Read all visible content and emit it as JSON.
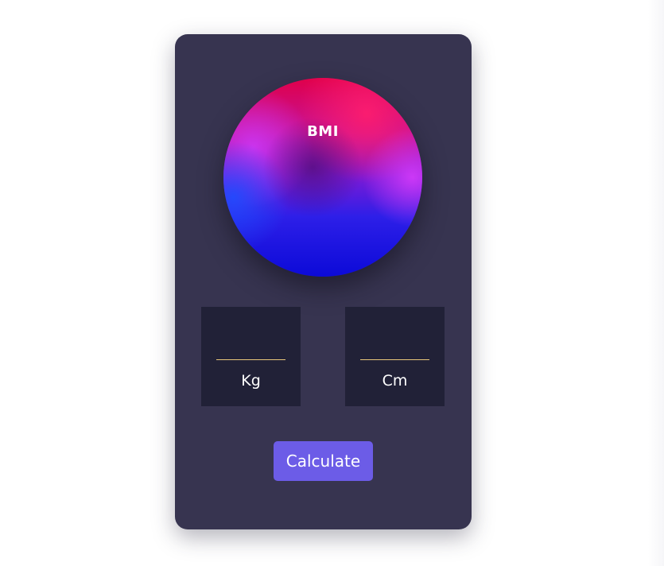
{
  "app": {
    "badge_title": "BMI"
  },
  "inputs": {
    "weight": {
      "value": "",
      "unit_label": "Kg"
    },
    "height": {
      "value": "",
      "unit_label": "Cm"
    }
  },
  "actions": {
    "calculate_label": "Calculate"
  },
  "colors": {
    "card_bg": "#373450",
    "input_box_bg": "#212137",
    "underline": "#e8c77a",
    "button_bg": "#6c5ce7",
    "orb_top": "#e0004a",
    "orb_mid": "#9b1fd0",
    "orb_bottom": "#1010e0"
  },
  "icons": {
    "orb": "smoke-gradient-orb"
  }
}
